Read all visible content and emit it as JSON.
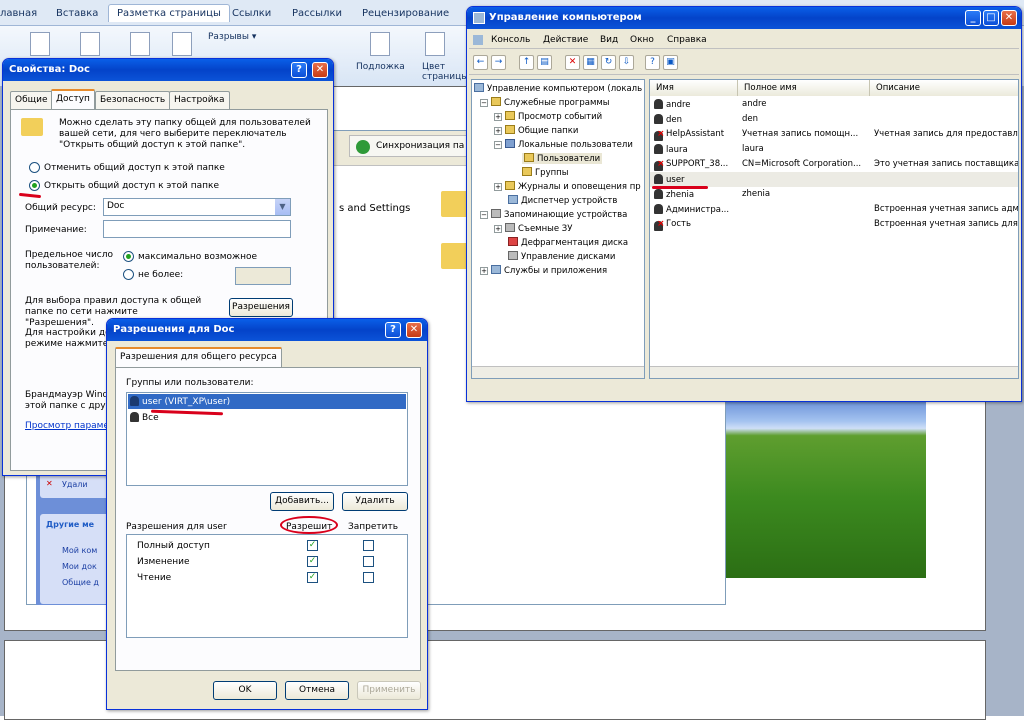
{
  "word": {
    "ribbon_tabs": [
      "лавная",
      "Вставка",
      "Разметка страницы",
      "Ссылки",
      "Рассылки",
      "Рецензирование"
    ],
    "breaks_label": "Разрывы ▾",
    "watermark_label": "Подложка",
    "page_color_label": "Цвет страницы",
    "sync_button": "Синхронизация па",
    "settings_text": "s and Settings",
    "sidebar": {
      "delete": "Удали",
      "other_places": "Другие ме",
      "links": [
        "Мой ком",
        "Мои док",
        "Общие д"
      ]
    }
  },
  "props": {
    "title": "Свойства: Doc",
    "tabs": [
      "Общие",
      "Доступ",
      "Безопасность",
      "Настройка"
    ],
    "info_text": "Можно сделать эту папку общей для пользователей вашей сети, для чего выберите переключатель \"Открыть общий доступ к этой папке\".",
    "radio_off": "Отменить общий доступ к этой папке",
    "radio_on": "Открыть общий доступ к этой папке",
    "share_label": "Общий ресурс:",
    "share_value": "Doc",
    "note_label": "Примечание:",
    "limit_label": "Предельное число пользователей:",
    "max_label": "максимально возможное",
    "not_more_label": "не более:",
    "perm_text": "Для выбора правил доступа к общей папке по сети нажмите \"Разрешения\".",
    "perm_button": "Разрешения",
    "offline_text": "Для настройки до режиме нажмите",
    "firewall_text": "Брандмауэр Windo этой папке с друг",
    "view_link": "Просмотр парамет"
  },
  "perms": {
    "title": "Разрешения для Doc",
    "tab": "Разрешения для общего ресурса",
    "groups_label": "Группы или пользователи:",
    "users": [
      "user (VIRT_XP\\user)",
      "Все"
    ],
    "add_button": "Добавить...",
    "remove_button": "Удалить",
    "perms_for": "Разрешения для user",
    "allow_col": "Разрешит",
    "deny_col": "Запретить",
    "rows": [
      {
        "name": "Полный доступ",
        "allow": true,
        "deny": false
      },
      {
        "name": "Изменение",
        "allow": true,
        "deny": false
      },
      {
        "name": "Чтение",
        "allow": true,
        "deny": false
      }
    ],
    "ok": "OK",
    "cancel": "Отмена",
    "apply": "Применить"
  },
  "mgmt": {
    "title": "Управление компьютером",
    "menu": [
      "Консоль",
      "Действие",
      "Вид",
      "Окно",
      "Справка"
    ],
    "tree": [
      {
        "label": "Управление компьютером (локаль",
        "level": 0,
        "exp": "",
        "selected": false
      },
      {
        "label": "Служебные программы",
        "level": 1,
        "exp": "−",
        "selected": false
      },
      {
        "label": "Просмотр событий",
        "level": 2,
        "exp": "+",
        "selected": false
      },
      {
        "label": "Общие папки",
        "level": 2,
        "exp": "+",
        "selected": false
      },
      {
        "label": "Локальные пользователи",
        "level": 2,
        "exp": "−",
        "selected": false
      },
      {
        "label": "Пользователи",
        "level": 3,
        "exp": "",
        "selected": true
      },
      {
        "label": "Группы",
        "level": 3,
        "exp": "",
        "selected": false
      },
      {
        "label": "Журналы и оповещения пр",
        "level": 2,
        "exp": "+",
        "selected": false
      },
      {
        "label": "Диспетчер устройств",
        "level": 2,
        "exp": "",
        "selected": false
      },
      {
        "label": "Запоминающие устройства",
        "level": 1,
        "exp": "−",
        "selected": false
      },
      {
        "label": "Съемные ЗУ",
        "level": 2,
        "exp": "+",
        "selected": false
      },
      {
        "label": "Дефрагментация диска",
        "level": 2,
        "exp": "",
        "selected": false
      },
      {
        "label": "Управление дисками",
        "level": 2,
        "exp": "",
        "selected": false
      },
      {
        "label": "Службы и приложения",
        "level": 1,
        "exp": "+",
        "selected": false
      }
    ],
    "columns": [
      "Имя",
      "Полное имя",
      "Описание"
    ],
    "users": [
      {
        "name": "andre",
        "full": "andre",
        "desc": "",
        "disabled": false
      },
      {
        "name": "den",
        "full": "den",
        "desc": "",
        "disabled": false
      },
      {
        "name": "HelpAssistant",
        "full": "Учетная запись помощн...",
        "desc": "Учетная запись для предоставл",
        "disabled": true
      },
      {
        "name": "laura",
        "full": "laura",
        "desc": "",
        "disabled": false
      },
      {
        "name": "SUPPORT_38...",
        "full": "CN=Microsoft Corporation...",
        "desc": "Это учетная запись поставщика",
        "disabled": true
      },
      {
        "name": "user",
        "full": "",
        "desc": "",
        "disabled": false
      },
      {
        "name": "zhenia",
        "full": "zhenia",
        "desc": "",
        "disabled": false
      },
      {
        "name": "Администра...",
        "full": "",
        "desc": "Встроенная учетная запись адм",
        "disabled": false
      },
      {
        "name": "Гость",
        "full": "",
        "desc": "Встроенная учетная запись для",
        "disabled": true
      }
    ]
  }
}
